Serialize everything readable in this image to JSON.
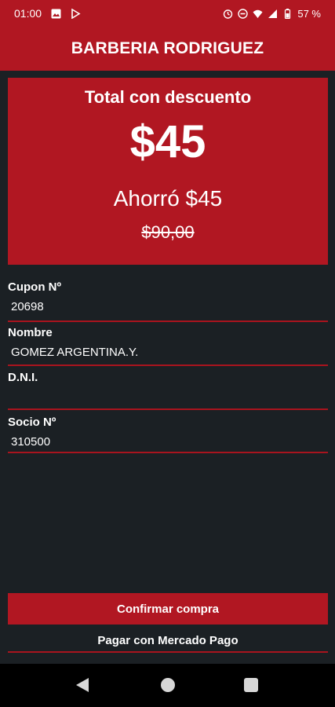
{
  "status_bar": {
    "time": "01:00",
    "battery": "57 %",
    "icons": [
      "image-icon",
      "play-store-icon",
      "alarm-icon",
      "do-not-disturb-icon",
      "wifi-icon",
      "signal-icon",
      "battery-icon"
    ]
  },
  "app": {
    "title": "BARBERIA RODRIGUEZ",
    "accent_color": "#b11722",
    "background_color": "#1b2024"
  },
  "summary": {
    "label": "Total con descuento",
    "total": "$45",
    "saved": "Ahorró $45",
    "original_price": "$90,00"
  },
  "fields": [
    {
      "label": "Cupon Nº",
      "value": "20698"
    },
    {
      "label": "Nombre",
      "value": "GOMEZ ARGENTINA.Y."
    },
    {
      "label": "D.N.I.",
      "value": ""
    },
    {
      "label": "Socio Nº",
      "value": "310500"
    }
  ],
  "actions": {
    "confirm_label": "Confirmar compra",
    "mercado_pago_label": "Pagar con Mercado Pago"
  }
}
